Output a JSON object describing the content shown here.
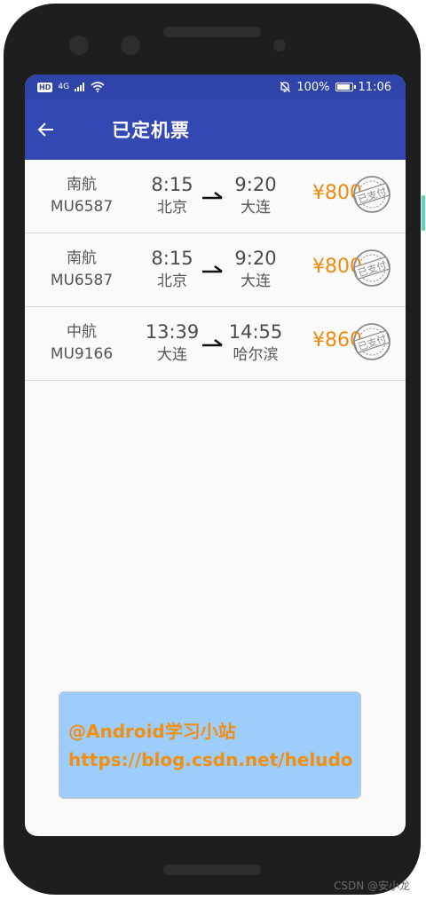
{
  "status_bar": {
    "network_badge": "HD",
    "network_type": "4G",
    "battery_percent": "100%",
    "battery_level": 1.0,
    "time": "11:06"
  },
  "toolbar": {
    "title": "已定机票"
  },
  "tickets": [
    {
      "airline": "南航",
      "flight_no": "MU6587",
      "dep_time": "8:15",
      "dep_city": "北京",
      "arr_time": "9:20",
      "arr_city": "大连",
      "price": "¥800",
      "stamp": "已支付"
    },
    {
      "airline": "南航",
      "flight_no": "MU6587",
      "dep_time": "8:15",
      "dep_city": "北京",
      "arr_time": "9:20",
      "arr_city": "大连",
      "price": "¥800",
      "stamp": "已支付"
    },
    {
      "airline": "中航",
      "flight_no": "MU9166",
      "dep_time": "13:39",
      "dep_city": "大连",
      "arr_time": "14:55",
      "arr_city": "哈尔滨",
      "price": "¥860",
      "stamp": "已支付"
    }
  ],
  "watermark": {
    "line1": "@Android学习小站",
    "line2": "https://blog.csdn.net/heludo"
  },
  "credit": "CSDN @安小⻰",
  "colors": {
    "status_bar": "#2f44a8",
    "toolbar": "#3448b3",
    "price": "#ef8a10",
    "watermark_bg": "#9ccdfb"
  }
}
